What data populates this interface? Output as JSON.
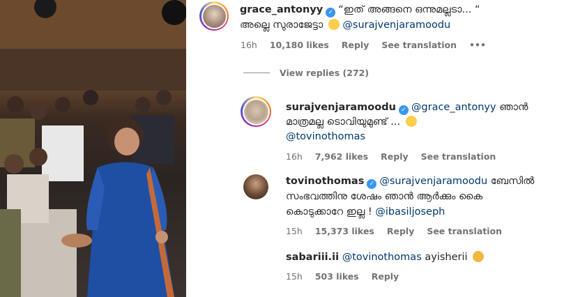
{
  "comments": [
    {
      "username": "grace_antonyy",
      "verified": true,
      "line1": "“ഇത് അങ്ങനെ ഒന്നുമല്ലടാ... “",
      "line2_text": "അല്ലെ സുരാജേട്ടാ",
      "line2_emoji": "laughing-emoji",
      "mention": "@surajvenjaramoodu",
      "time": "16h",
      "likes": "10,180 likes",
      "reply": "Reply",
      "see_translation": "See translation",
      "more": "•••"
    },
    {
      "username": "surajvenjaramoodu",
      "verified": true,
      "mention": "@grace_antonyy",
      "line1_text": "ഞാൻ",
      "line2_text": "മാത്രമല്ല ടൊവിയുമുണ്ട് ...",
      "line2_emoji": "eye-roll-emoji",
      "line3_mention": "@tovinothomas",
      "time": "16h",
      "likes": "7,962 likes",
      "reply": "Reply",
      "see_translation": "See translation"
    },
    {
      "username": "tovinothomas",
      "verified": true,
      "mention": "@surajvenjaramoodu",
      "line1_text": "ബേസിൽ",
      "line2_text": "സംഭവത്തിനു ശേഷം ഞാൻ ആർക്കും കൈ",
      "line3_text": "കൊടുക്കാറേ ഇല്ല !",
      "line3_mention": "@ibasiljoseph",
      "time": "15h",
      "likes": "15,373 likes",
      "reply": "Reply",
      "see_translation": "See translation"
    },
    {
      "username": "sabariii.ii",
      "mention": "@tovinothomas",
      "text": "ayisherii",
      "emoji": "cat-emoji",
      "time": "15h",
      "likes": "503 likes",
      "reply": "Reply"
    }
  ],
  "view_replies": "View replies (272)",
  "colors": {
    "mention": "#00376b",
    "meta": "#737373",
    "verified": "#3897f0"
  }
}
